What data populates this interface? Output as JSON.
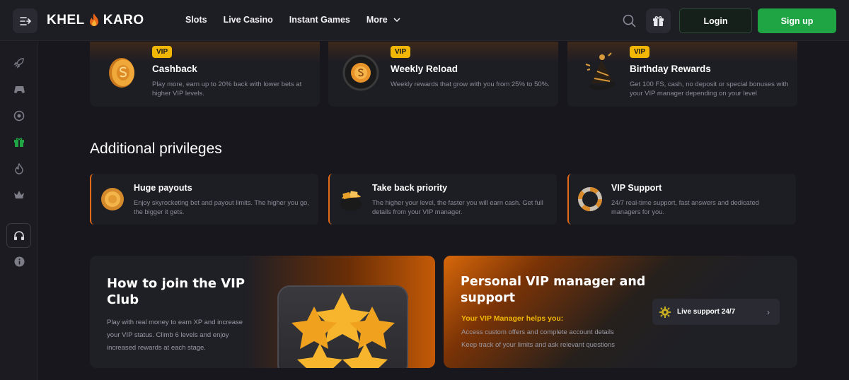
{
  "header": {
    "logo_left": "KHEL",
    "logo_right": "KARO",
    "nav": [
      "Slots",
      "Live Casino",
      "Instant Games",
      "More"
    ],
    "login_label": "Login",
    "signup_label": "Sign up"
  },
  "sidebar": {
    "items": [
      "rocket-icon",
      "gamepad-icon",
      "chip-icon",
      "gift-icon",
      "flame-icon",
      "crown-icon",
      "headset-icon",
      "info-icon"
    ]
  },
  "rewards": [
    {
      "badge": "VIP",
      "title": "Cashback",
      "desc": "Play more, earn up to 20% back with lower bets at higher VIP levels."
    },
    {
      "badge": "VIP",
      "title": "Weekly Reload",
      "desc": "Weekly rewards that grow with you from 25% to 50%."
    },
    {
      "badge": "VIP",
      "title": "Birthday Rewards",
      "desc": "Get 100 FS, cash, no deposit or special bonuses with your VIP manager depending on your level"
    }
  ],
  "privileges_title": "Additional privileges",
  "privileges": [
    {
      "title": "Huge payouts",
      "desc": "Enjoy skyrocketing bet and payout limits. The higher you go, the bigger it gets."
    },
    {
      "title": "Take back priority",
      "desc": "The higher your level, the faster you will earn cash. Get full details from your VIP manager."
    },
    {
      "title": "VIP Support",
      "desc": "24/7 real-time support, fast answers and dedicated managers for you."
    }
  ],
  "join": {
    "title": "How to join the VIP Club",
    "desc": "Play with real money to earn XP and increase your VIP status. Climb 6 levels and enjoy increased rewards at each stage."
  },
  "manager": {
    "title": "Personal VIP manager and support",
    "subtitle": "Your VIP Manager helps you:",
    "lines": [
      "Access custom offers and complete account details",
      "Keep track of your limits and ask relevant questions"
    ],
    "live_support_label": "Live support 24/7"
  },
  "colors": {
    "accent_green": "#1fa544",
    "accent_orange": "#e56a18",
    "vip_yellow": "#f2b705",
    "background": "#17171d"
  }
}
